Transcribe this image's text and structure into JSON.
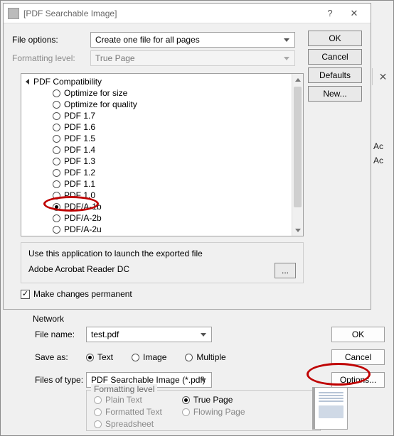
{
  "fg": {
    "title": "[PDF Searchable Image]",
    "help_glyph": "?",
    "close_glyph": "✕",
    "file_options_label": "File options:",
    "file_options_value": "Create one file for all pages",
    "formatting_level_label": "Formatting level:",
    "formatting_level_value": "True Page",
    "buttons": {
      "ok": "OK",
      "cancel": "Cancel",
      "defaults": "Defaults",
      "new": "New..."
    },
    "tree_group": "PDF Compatibility",
    "tree_items": [
      {
        "label": "Optimize for size",
        "selected": false
      },
      {
        "label": "Optimize for quality",
        "selected": false
      },
      {
        "label": "PDF 1.7",
        "selected": false
      },
      {
        "label": "PDF 1.6",
        "selected": false
      },
      {
        "label": "PDF 1.5",
        "selected": false
      },
      {
        "label": "PDF 1.4",
        "selected": false
      },
      {
        "label": "PDF 1.3",
        "selected": false
      },
      {
        "label": "PDF 1.2",
        "selected": false
      },
      {
        "label": "PDF 1.1",
        "selected": false
      },
      {
        "label": "PDF 1.0",
        "selected": false
      },
      {
        "label": "PDF/A-1b",
        "selected": true
      },
      {
        "label": "PDF/A-2b",
        "selected": false
      },
      {
        "label": "PDF/A-2u",
        "selected": false
      }
    ],
    "launch_caption": "Use this application to launch the exported file",
    "launch_app": "Adobe Acrobat Reader DC",
    "browse_label": "...",
    "make_permanent_label": "Make changes permanent",
    "make_permanent_checked": true
  },
  "bg": {
    "peek_lines": [
      "Ac",
      "Ac"
    ],
    "network_label": "Network",
    "filename_label": "File name:",
    "filename_value": "test.pdf",
    "saveas_label": "Save as:",
    "saveas_options": [
      {
        "label": "Text",
        "selected": true
      },
      {
        "label": "Image",
        "selected": false
      },
      {
        "label": "Multiple",
        "selected": false
      }
    ],
    "files_of_type_label": "Files of type:",
    "files_of_type_value": "PDF Searchable Image (*.pdf)",
    "ok_label": "OK",
    "cancel_label": "Cancel",
    "options_label": "Options...",
    "fmt_legend": "Formatting level",
    "fmt_options_col1": [
      {
        "label": "Plain Text",
        "selected": false,
        "enabled": false
      },
      {
        "label": "Formatted Text",
        "selected": false,
        "enabled": false
      },
      {
        "label": "Spreadsheet",
        "selected": false,
        "enabled": false
      }
    ],
    "fmt_options_col2": [
      {
        "label": "True Page",
        "selected": true,
        "enabled": true
      },
      {
        "label": "Flowing Page",
        "selected": false,
        "enabled": false
      }
    ]
  }
}
